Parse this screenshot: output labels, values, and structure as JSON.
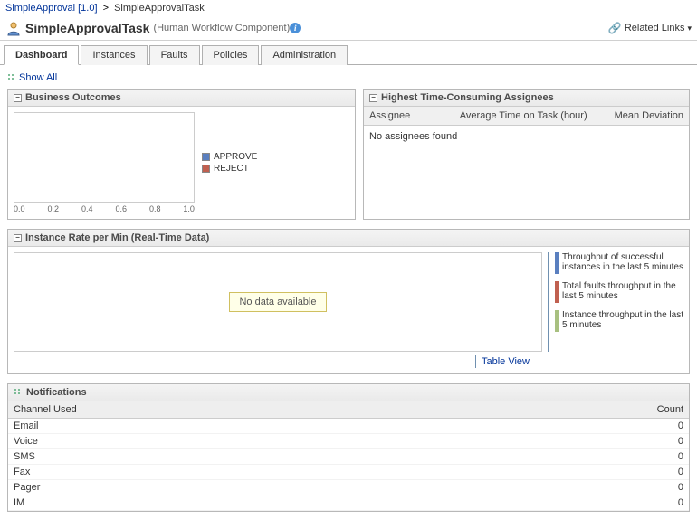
{
  "breadcrumb": {
    "parent": "SimpleApproval [1.0]",
    "sep": ">",
    "current": "SimpleApprovalTask"
  },
  "header": {
    "title": "SimpleApprovalTask",
    "subtitle": "(Human Workflow Component)",
    "related": "Related Links"
  },
  "tabs": [
    "Dashboard",
    "Instances",
    "Faults",
    "Policies",
    "Administration"
  ],
  "activeTab": 0,
  "showAll": "Show All",
  "panels": {
    "outcomes": {
      "title": "Business Outcomes"
    },
    "assignees": {
      "title": "Highest Time-Consuming Assignees",
      "cols": {
        "a": "Assignee",
        "b": "Average Time on Task (hour)",
        "c": "Mean Deviation"
      },
      "empty": "No assignees found"
    },
    "instanceRate": {
      "title": "Instance Rate per Min (Real-Time Data)",
      "nodata": "No data available",
      "legend": {
        "a": "Throughput of successful instances in the last 5 minutes",
        "b": "Total faults throughput in the last 5 minutes",
        "c": "Instance throughput in the last 5 minutes"
      },
      "tableView": "Table View"
    },
    "notifications": {
      "title": "Notifications",
      "cols": {
        "channel": "Channel Used",
        "count": "Count"
      },
      "rows": [
        {
          "channel": "Email",
          "count": 0
        },
        {
          "channel": "Voice",
          "count": 0
        },
        {
          "channel": "SMS",
          "count": 0
        },
        {
          "channel": "Fax",
          "count": 0
        },
        {
          "channel": "Pager",
          "count": 0
        },
        {
          "channel": "IM",
          "count": 0
        }
      ]
    }
  },
  "chart_data": {
    "type": "bar",
    "categories": [],
    "series": [
      {
        "name": "APPROVE",
        "color": "#5a7fbf",
        "values": []
      },
      {
        "name": "REJECT",
        "color": "#c06050",
        "values": []
      }
    ],
    "xlabel": "",
    "ylabel": "",
    "xlim": [
      0.0,
      1.0
    ],
    "xticks": [
      "0.0",
      "0.2",
      "0.4",
      "0.6",
      "0.8",
      "1.0"
    ]
  }
}
